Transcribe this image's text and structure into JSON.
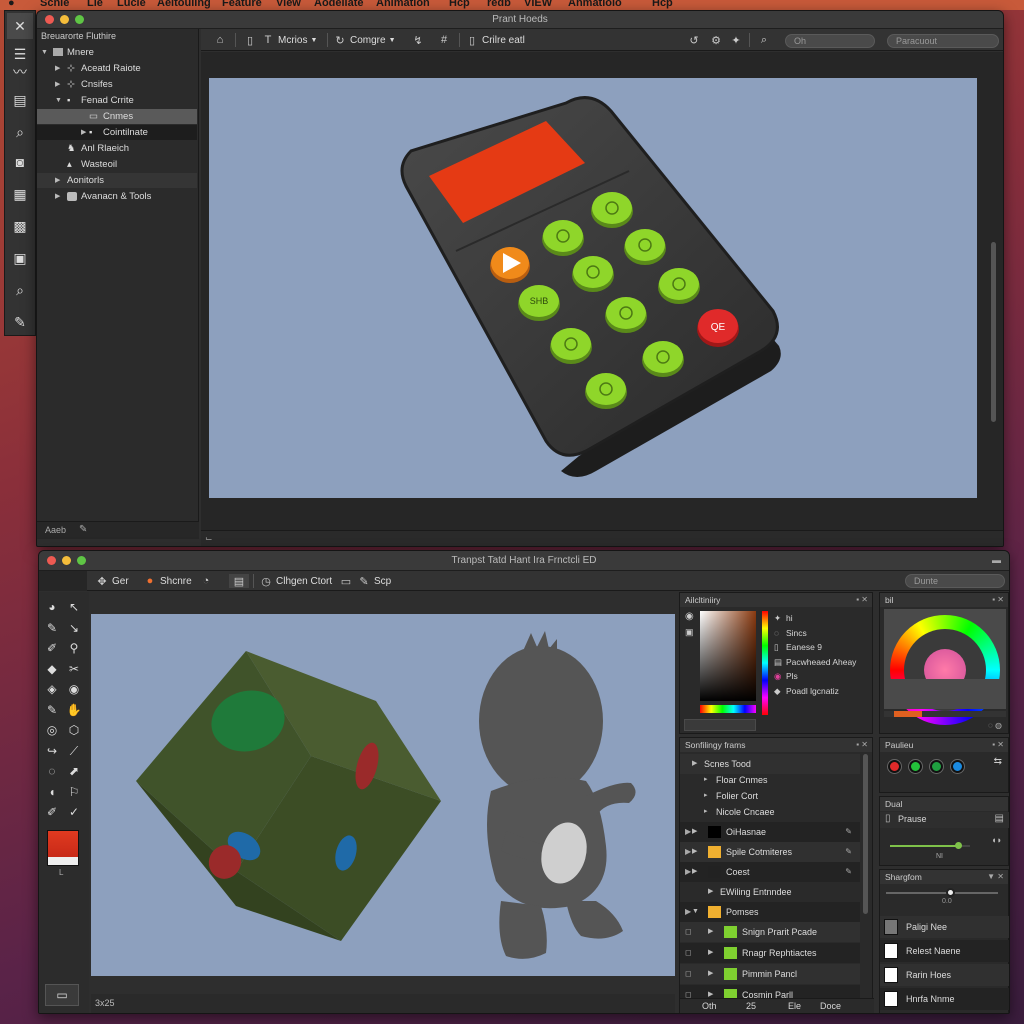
{
  "menubar": {
    "items": [
      "Scnle",
      "Lle",
      "Lucle",
      "Aeltouling",
      "Feature",
      "View",
      "Aodellate",
      "Animation",
      "Hcp",
      "redb",
      "VIEW",
      "Anmatioio",
      "Hcp"
    ]
  },
  "top_window": {
    "title": "Prant Hoeds",
    "toolbar": {
      "mode_label": "Mcrios",
      "complete_label": "Comgre",
      "edit_label": "Crilre eatl",
      "search_placeholder": "Oh",
      "filter_placeholder": "Paracuout"
    },
    "outliner": {
      "header": "Breuarorte Fluthire",
      "items": [
        {
          "label": "Mnere"
        },
        {
          "label": "Aceatd Raiote"
        },
        {
          "label": "Cnsifes"
        },
        {
          "label": "Fenad Crrite"
        },
        {
          "label": "Cnmes"
        },
        {
          "label": "Cointilnate"
        },
        {
          "label": "Anl Rlaeich"
        },
        {
          "label": "Wasteoil"
        },
        {
          "label": "Aonitorls"
        },
        {
          "label": "Avanacn & Tools"
        }
      ],
      "footer": "Aaeb"
    },
    "keypad": {
      "screen_color": "#e53a14",
      "body_color": "#3a3a3a",
      "key_color": "#8fd62a",
      "play_color": "#f08a1a",
      "stop_color": "#e02a2a",
      "stop_label": "QE",
      "key_labels": [
        "",
        "",
        "",
        "",
        "",
        "SHB",
        "",
        "",
        ""
      ]
    }
  },
  "bottom_window": {
    "title": "Tranpst Tatd Hant Ira Frnctcli ED",
    "toolbar": {
      "go_label": "Ger",
      "share_label": "Shcnre",
      "chain_label": "Clhgen Ctort",
      "step_label": "Scp",
      "search_placeholder": "Dunte"
    },
    "footer_left": "3x25",
    "color_panel": {
      "header": "Ailcltiniiry",
      "items": [
        {
          "icon": "",
          "label": "hi"
        },
        {
          "icon": "",
          "label": "Sincs"
        },
        {
          "icon": "",
          "label": "Eanese 9"
        },
        {
          "icon": "",
          "label": "Pacwheaed Aheay"
        },
        {
          "icon": "",
          "label": "Pls"
        },
        {
          "icon": "",
          "label": "Poadl lgcnatiz"
        }
      ]
    },
    "wheel_panel": {
      "header": "bil"
    },
    "scene_panel": {
      "header": "Sonfilingy frams",
      "rows": [
        {
          "label": "Scnes Tood"
        },
        {
          "label": "Floar Cnmes"
        },
        {
          "label": "Folier Cort"
        },
        {
          "label": "Nicole Cncaee"
        },
        {
          "label": "OiHasnae"
        },
        {
          "label": "Spile Cotmiteres"
        },
        {
          "label": "Coest"
        },
        {
          "label": "EWiling Entnndee"
        },
        {
          "label": "Pomses"
        },
        {
          "label": "Snign Prarit Pcade"
        },
        {
          "label": "Rnagr Rephtiactes"
        },
        {
          "label": "Pimmin Pancl"
        },
        {
          "label": "Cosmin Parll"
        }
      ],
      "footer": [
        "Oth",
        "25",
        "Ele",
        "Doce"
      ]
    },
    "right_panels": {
      "pauleu_header": "Paulieu",
      "chip_colors": [
        "#e02a2a",
        "#23c03a",
        "#1fa040",
        "#1a8ae0"
      ],
      "dual_header": "Dual",
      "preuse_label": "Prause",
      "slider_value": 0.85,
      "slider_caption": "NI",
      "shargfom_header": "Shargfom",
      "layers": [
        "Paligi Nee",
        "Relest Naene",
        "Rarin Hoes",
        "Hnrfa Nnme"
      ]
    },
    "cube": {
      "face_color": "#45562c",
      "dot_green": "#1f7a3a",
      "dot_red": "#9a2a2a",
      "dot_blue": "#1f6aa8"
    },
    "figure": {
      "body_color": "#555555",
      "belly_color": "#cfcfcf"
    }
  }
}
